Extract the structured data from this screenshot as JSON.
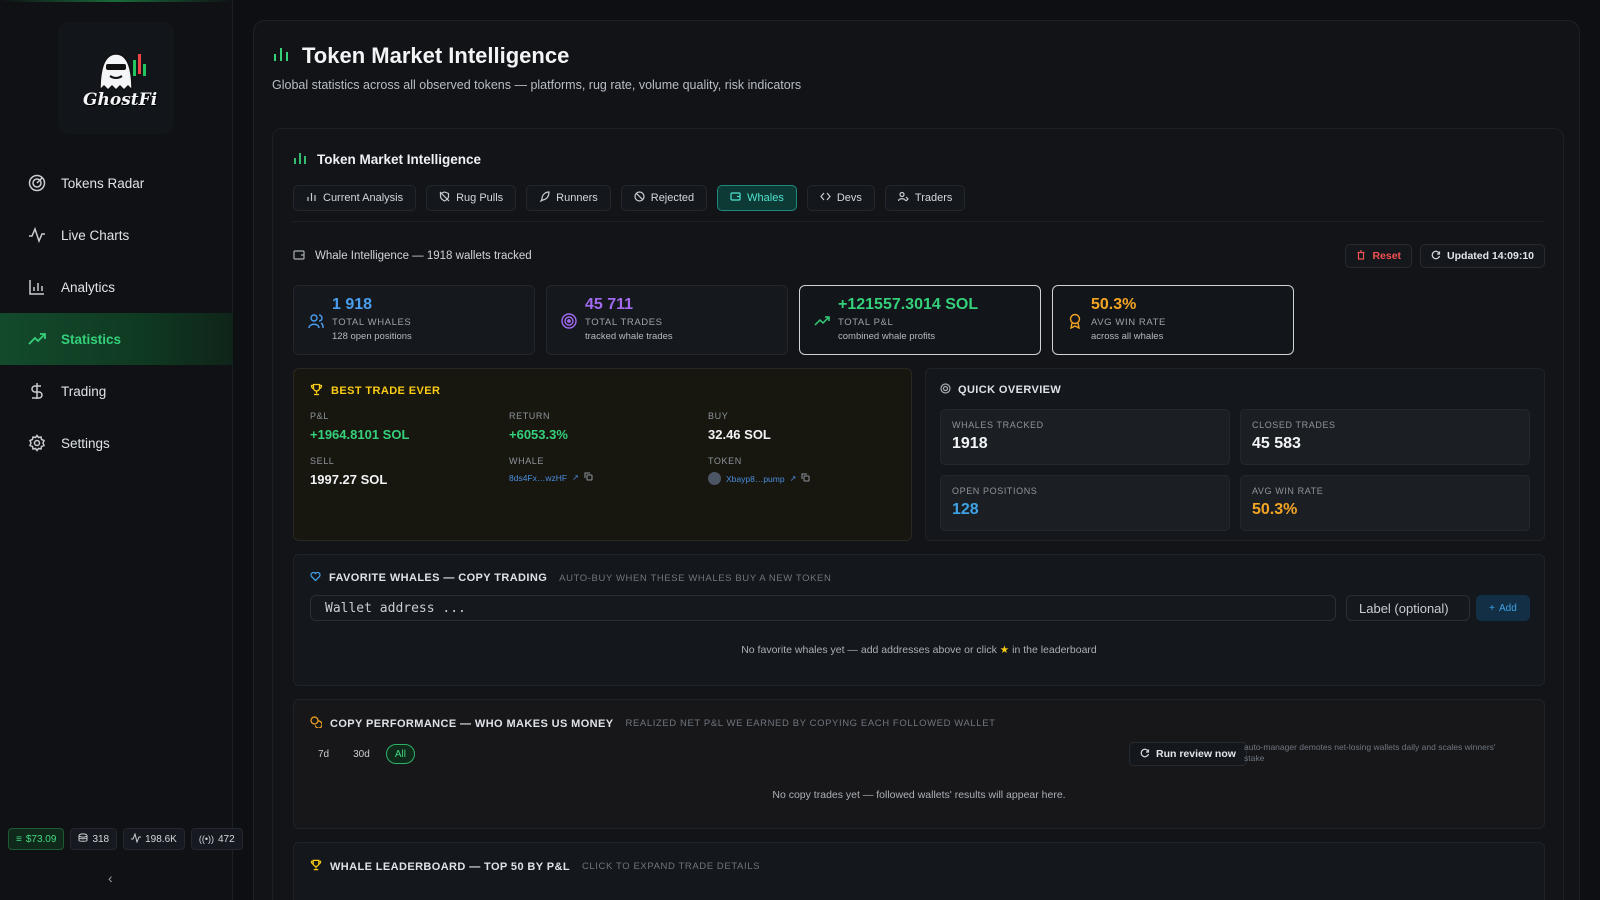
{
  "brand": {
    "name": "GhostFi"
  },
  "sidebar": {
    "items": [
      {
        "label": "Tokens Radar",
        "icon": "radar-icon",
        "active": false
      },
      {
        "label": "Live Charts",
        "icon": "pulse-icon",
        "active": false
      },
      {
        "label": "Analytics",
        "icon": "bar-chart-icon",
        "active": false
      },
      {
        "label": "Statistics",
        "icon": "trending-up-icon",
        "active": true
      },
      {
        "label": "Trading",
        "icon": "dollar-icon",
        "active": false
      },
      {
        "label": "Settings",
        "icon": "gear-icon",
        "active": false
      }
    ],
    "status": {
      "balance": "$73.09",
      "db_count": "318",
      "activity": "198.6K",
      "signal": "472"
    }
  },
  "header": {
    "title": "Token Market Intelligence",
    "subtitle": "Global statistics across all observed tokens — platforms, rug rate, volume quality, risk indicators"
  },
  "panel": {
    "title": "Token Market Intelligence",
    "tabs": [
      {
        "label": "Current Analysis",
        "icon": "bar-chart-icon",
        "active": false
      },
      {
        "label": "Rug Pulls",
        "icon": "shield-off-icon",
        "active": false
      },
      {
        "label": "Runners",
        "icon": "rocket-icon",
        "active": false
      },
      {
        "label": "Rejected",
        "icon": "ban-icon",
        "active": false
      },
      {
        "label": "Whales",
        "icon": "wallet-icon",
        "active": true
      },
      {
        "label": "Devs",
        "icon": "code-icon",
        "active": false
      },
      {
        "label": "Traders",
        "icon": "users-icon",
        "active": false
      }
    ]
  },
  "whale": {
    "heading": "Whale Intelligence — 1918 wallets tracked",
    "reset_label": "Reset",
    "updated_label": "Updated 14:09:10",
    "stats": [
      {
        "value": "1 918",
        "label": "TOTAL WHALES",
        "sub": "128 open positions",
        "color": "#4a9ef0",
        "icon": "users-icon",
        "highlight": false
      },
      {
        "value": "45 711",
        "label": "TOTAL TRADES",
        "sub": "tracked whale trades",
        "color": "#a26af0",
        "icon": "target-icon",
        "highlight": false
      },
      {
        "value": "+121557.3014 SOL",
        "label": "TOTAL P&L",
        "sub": "combined whale profits",
        "color": "#34d07a",
        "icon": "trending-up-icon",
        "highlight": true
      },
      {
        "value": "50.3%",
        "label": "AVG WIN RATE",
        "sub": "across all whales",
        "color": "#f5a524",
        "icon": "award-icon",
        "highlight": true
      }
    ],
    "best_trade": {
      "title": "BEST TRADE EVER",
      "pnl_label": "P&L",
      "pnl_value": "+1964.8101 SOL",
      "return_label": "RETURN",
      "return_value": "+6053.3%",
      "buy_label": "BUY",
      "buy_value": "32.46 SOL",
      "sell_label": "SELL",
      "sell_value": "1997.27 SOL",
      "whale_label": "WHALE",
      "whale_value": "8ds4Fx…wzHF",
      "token_label": "TOKEN",
      "token_value": "Xbayp8…pump"
    },
    "overview": {
      "title": "QUICK OVERVIEW",
      "cells": [
        {
          "label": "WHALES TRACKED",
          "value": "1918",
          "color": "#f2f4f6"
        },
        {
          "label": "CLOSED TRADES",
          "value": "45 583",
          "color": "#f2f4f6"
        },
        {
          "label": "OPEN POSITIONS",
          "value": "128",
          "color": "#3ea2e6"
        },
        {
          "label": "AVG WIN RATE",
          "value": "50.3%",
          "color": "#f5a524"
        }
      ]
    }
  },
  "favorites": {
    "title": "FAVORITE WHALES — COPY TRADING",
    "hint": "AUTO-BUY WHEN THESE WHALES BUY A NEW TOKEN",
    "wallet_placeholder": "Wallet address ...",
    "label_placeholder": "Label (optional)",
    "add_label": "Add",
    "empty_before": "No favorite whales yet — add addresses above or click",
    "empty_after": "in the leaderboard"
  },
  "copy_perf": {
    "title": "COPY PERFORMANCE — WHO MAKES US MONEY",
    "hint": "REALIZED NET P&L WE EARNED BY COPYING EACH FOLLOWED WALLET",
    "ranges": [
      {
        "label": "7d",
        "active": false
      },
      {
        "label": "30d",
        "active": false
      },
      {
        "label": "All",
        "active": true
      }
    ],
    "run_label": "Run review now",
    "run_note": "auto-manager demotes net-losing wallets daily and scales winners' stake",
    "empty": "No copy trades yet — followed wallets' results will appear here."
  },
  "leaderboard": {
    "title": "WHALE LEADERBOARD — TOP 50 BY P&L",
    "hint": "CLICK TO EXPAND TRADE DETAILS"
  }
}
